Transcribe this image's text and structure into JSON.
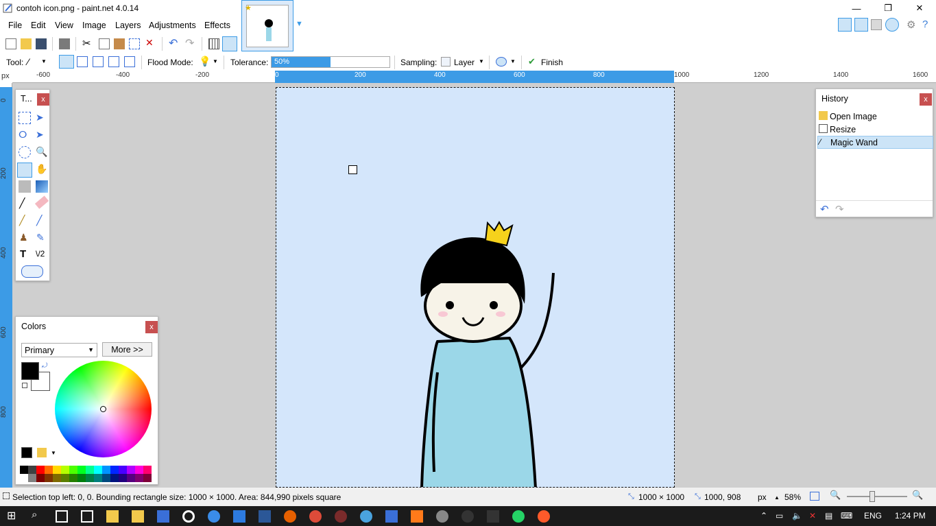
{
  "window": {
    "title": "contoh icon.png - paint.net 4.0.14",
    "controls": {
      "minimize": "—",
      "restore": "❐",
      "close": "✕"
    }
  },
  "menu": [
    "File",
    "Edit",
    "View",
    "Image",
    "Layers",
    "Adjustments",
    "Effects"
  ],
  "tool_options": {
    "tool_label": "Tool:",
    "flood_mode_label": "Flood Mode:",
    "tolerance_label": "Tolerance:",
    "tolerance_value": "50%",
    "tolerance_fraction": 0.5,
    "sampling_label": "Sampling:",
    "sampling_value": "Layer",
    "finish_label": "Finish"
  },
  "ruler": {
    "unit": "px",
    "h_labels": [
      "-600",
      "-400",
      "-200",
      "0",
      "200",
      "400",
      "600",
      "800",
      "1000",
      "1200",
      "1400",
      "1600"
    ],
    "v_labels": [
      "0",
      "200",
      "400",
      "600",
      "800"
    ]
  },
  "tools_panel": {
    "title": "T...",
    "close": "x"
  },
  "history_panel": {
    "title": "History",
    "close": "x",
    "items": [
      "Open Image",
      "Resize",
      "Magic Wand"
    ],
    "selected": "Magic Wand"
  },
  "colors_panel": {
    "title": "Colors",
    "close": "x",
    "mode": "Primary",
    "more_button": "More >>",
    "primary_color": "#000000",
    "secondary_color": "#ffffff",
    "palette_top": [
      "#000000",
      "#404040",
      "#ff0000",
      "#ff6a00",
      "#ffd800",
      "#b6ff00",
      "#4cff00",
      "#00ff21",
      "#00ff90",
      "#00ffff",
      "#0094ff",
      "#0026ff",
      "#4800ff",
      "#b200ff",
      "#ff00dc",
      "#ff006e"
    ],
    "palette_bottom": [
      "#ffffff",
      "#808080",
      "#7f0000",
      "#7f3300",
      "#7f6a00",
      "#5b7f00",
      "#267f00",
      "#007f0e",
      "#007f46",
      "#007f7f",
      "#004a7f",
      "#00137f",
      "#21007f",
      "#57007f",
      "#7f006e",
      "#7f0037"
    ]
  },
  "status": {
    "selection_text": "Selection top left: 0, 0. Bounding rectangle size: 1000 × 1000. Area: 844,990 pixels square",
    "image_size": "1000 × 1000",
    "cursor_pos": "1000, 908",
    "unit": "px",
    "zoom": "58%"
  },
  "taskbar": {
    "language": "ENG",
    "time": "1:24 PM"
  }
}
